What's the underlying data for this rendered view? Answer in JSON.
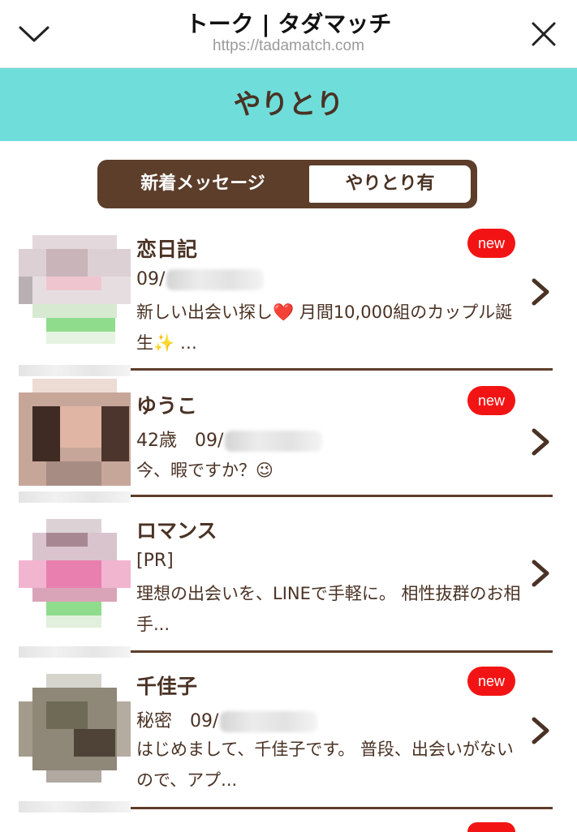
{
  "browser": {
    "title": "トーク | タダマッチ",
    "url": "https://tadamatch.com"
  },
  "section": {
    "title": "やりとり"
  },
  "tabs": [
    {
      "label": "新着メッセージ",
      "selected": true
    },
    {
      "label": "やりとり有",
      "selected": false
    }
  ],
  "messages": [
    {
      "name": "恋日記",
      "meta": "09/",
      "preview": "新しい出会い探し❤️ 月間10,000組のカップル誕生✨ …",
      "badge": "new"
    },
    {
      "name": "ゆうこ",
      "meta": "42歳　09/",
      "preview": "今、暇ですか？😉",
      "badge": "new"
    },
    {
      "name": "ロマンス",
      "meta": "[PR]",
      "preview": "理想の出会いを、LINEで手軽に。 相性抜群のお相手...",
      "badge": ""
    },
    {
      "name": "千佳子",
      "meta": "秘密　09/",
      "preview": "はじめまして、千佳子です。 普段、出会いがないので、アプ...",
      "badge": "new"
    }
  ],
  "colors": {
    "header_bg": "#6fdedb",
    "brown": "#5d3e2a",
    "text": "#4a3224",
    "badge": "#f21414"
  },
  "icons": {
    "collapse": "chevron-down-icon",
    "close": "close-icon",
    "row_arrow": "chevron-right-icon"
  }
}
